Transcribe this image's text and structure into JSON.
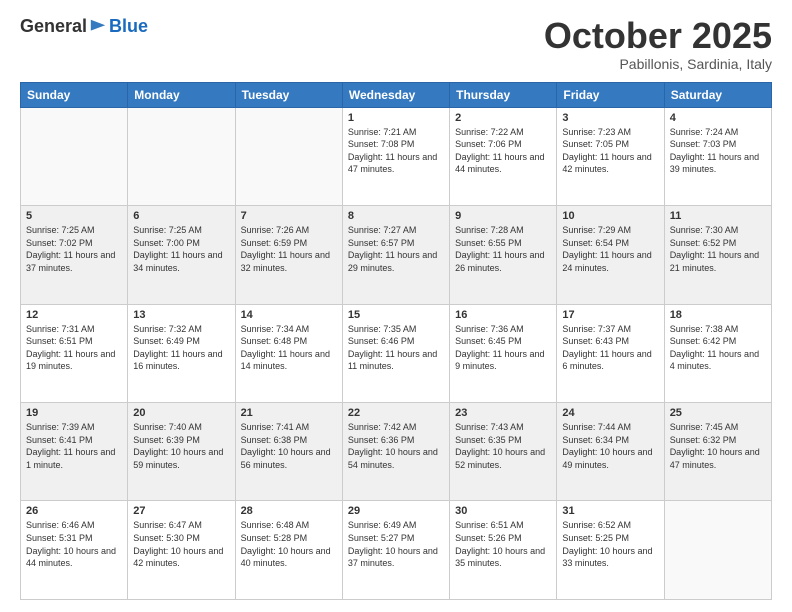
{
  "logo": {
    "general": "General",
    "blue": "Blue"
  },
  "header": {
    "month": "October 2025",
    "location": "Pabillonis, Sardinia, Italy"
  },
  "weekdays": [
    "Sunday",
    "Monday",
    "Tuesday",
    "Wednesday",
    "Thursday",
    "Friday",
    "Saturday"
  ],
  "weeks": [
    [
      {
        "day": "",
        "info": ""
      },
      {
        "day": "",
        "info": ""
      },
      {
        "day": "",
        "info": ""
      },
      {
        "day": "1",
        "info": "Sunrise: 7:21 AM\nSunset: 7:08 PM\nDaylight: 11 hours and 47 minutes."
      },
      {
        "day": "2",
        "info": "Sunrise: 7:22 AM\nSunset: 7:06 PM\nDaylight: 11 hours and 44 minutes."
      },
      {
        "day": "3",
        "info": "Sunrise: 7:23 AM\nSunset: 7:05 PM\nDaylight: 11 hours and 42 minutes."
      },
      {
        "day": "4",
        "info": "Sunrise: 7:24 AM\nSunset: 7:03 PM\nDaylight: 11 hours and 39 minutes."
      }
    ],
    [
      {
        "day": "5",
        "info": "Sunrise: 7:25 AM\nSunset: 7:02 PM\nDaylight: 11 hours and 37 minutes."
      },
      {
        "day": "6",
        "info": "Sunrise: 7:25 AM\nSunset: 7:00 PM\nDaylight: 11 hours and 34 minutes."
      },
      {
        "day": "7",
        "info": "Sunrise: 7:26 AM\nSunset: 6:59 PM\nDaylight: 11 hours and 32 minutes."
      },
      {
        "day": "8",
        "info": "Sunrise: 7:27 AM\nSunset: 6:57 PM\nDaylight: 11 hours and 29 minutes."
      },
      {
        "day": "9",
        "info": "Sunrise: 7:28 AM\nSunset: 6:55 PM\nDaylight: 11 hours and 26 minutes."
      },
      {
        "day": "10",
        "info": "Sunrise: 7:29 AM\nSunset: 6:54 PM\nDaylight: 11 hours and 24 minutes."
      },
      {
        "day": "11",
        "info": "Sunrise: 7:30 AM\nSunset: 6:52 PM\nDaylight: 11 hours and 21 minutes."
      }
    ],
    [
      {
        "day": "12",
        "info": "Sunrise: 7:31 AM\nSunset: 6:51 PM\nDaylight: 11 hours and 19 minutes."
      },
      {
        "day": "13",
        "info": "Sunrise: 7:32 AM\nSunset: 6:49 PM\nDaylight: 11 hours and 16 minutes."
      },
      {
        "day": "14",
        "info": "Sunrise: 7:34 AM\nSunset: 6:48 PM\nDaylight: 11 hours and 14 minutes."
      },
      {
        "day": "15",
        "info": "Sunrise: 7:35 AM\nSunset: 6:46 PM\nDaylight: 11 hours and 11 minutes."
      },
      {
        "day": "16",
        "info": "Sunrise: 7:36 AM\nSunset: 6:45 PM\nDaylight: 11 hours and 9 minutes."
      },
      {
        "day": "17",
        "info": "Sunrise: 7:37 AM\nSunset: 6:43 PM\nDaylight: 11 hours and 6 minutes."
      },
      {
        "day": "18",
        "info": "Sunrise: 7:38 AM\nSunset: 6:42 PM\nDaylight: 11 hours and 4 minutes."
      }
    ],
    [
      {
        "day": "19",
        "info": "Sunrise: 7:39 AM\nSunset: 6:41 PM\nDaylight: 11 hours and 1 minute."
      },
      {
        "day": "20",
        "info": "Sunrise: 7:40 AM\nSunset: 6:39 PM\nDaylight: 10 hours and 59 minutes."
      },
      {
        "day": "21",
        "info": "Sunrise: 7:41 AM\nSunset: 6:38 PM\nDaylight: 10 hours and 56 minutes."
      },
      {
        "day": "22",
        "info": "Sunrise: 7:42 AM\nSunset: 6:36 PM\nDaylight: 10 hours and 54 minutes."
      },
      {
        "day": "23",
        "info": "Sunrise: 7:43 AM\nSunset: 6:35 PM\nDaylight: 10 hours and 52 minutes."
      },
      {
        "day": "24",
        "info": "Sunrise: 7:44 AM\nSunset: 6:34 PM\nDaylight: 10 hours and 49 minutes."
      },
      {
        "day": "25",
        "info": "Sunrise: 7:45 AM\nSunset: 6:32 PM\nDaylight: 10 hours and 47 minutes."
      }
    ],
    [
      {
        "day": "26",
        "info": "Sunrise: 6:46 AM\nSunset: 5:31 PM\nDaylight: 10 hours and 44 minutes."
      },
      {
        "day": "27",
        "info": "Sunrise: 6:47 AM\nSunset: 5:30 PM\nDaylight: 10 hours and 42 minutes."
      },
      {
        "day": "28",
        "info": "Sunrise: 6:48 AM\nSunset: 5:28 PM\nDaylight: 10 hours and 40 minutes."
      },
      {
        "day": "29",
        "info": "Sunrise: 6:49 AM\nSunset: 5:27 PM\nDaylight: 10 hours and 37 minutes."
      },
      {
        "day": "30",
        "info": "Sunrise: 6:51 AM\nSunset: 5:26 PM\nDaylight: 10 hours and 35 minutes."
      },
      {
        "day": "31",
        "info": "Sunrise: 6:52 AM\nSunset: 5:25 PM\nDaylight: 10 hours and 33 minutes."
      },
      {
        "day": "",
        "info": ""
      }
    ]
  ]
}
